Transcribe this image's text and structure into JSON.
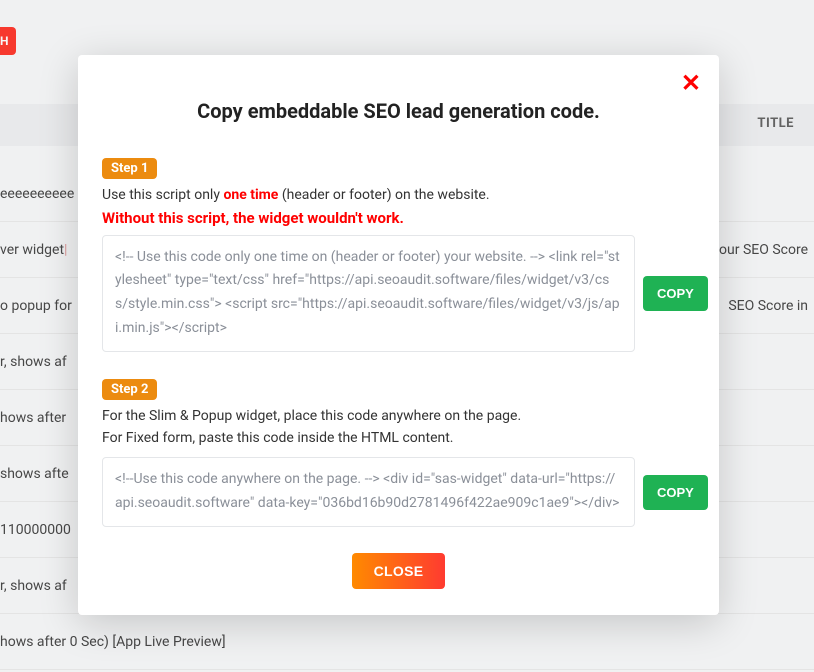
{
  "bg": {
    "top_btn": "H",
    "title_right": "TITLE",
    "rows_left": [
      "eeeeeeeeee",
      "ver widget ",
      "o popup for",
      "r, shows af",
      "hows after",
      "shows afte",
      "110000000",
      "r, shows af",
      "hows after 0 Sec) [App Live Preview]"
    ],
    "rows_right": [
      "our SEO Score",
      "SEO Score in"
    ],
    "row_left_tops": [
      166,
      222,
      278,
      334,
      390,
      446,
      502,
      558,
      614
    ],
    "row_right_tops": [
      222,
      278
    ]
  },
  "modal": {
    "title": "Copy embeddable SEO lead generation code.",
    "close_icon": "✕",
    "step1_badge": "Step 1",
    "step1_pre": "Use this script only ",
    "step1_bold": "one time",
    "step1_post": " (header or footer) on the website.",
    "step1_warn": "Without this script, the widget wouldn't work.",
    "code1": "<!-- Use this code only one time on (header or footer) your website. --> <link rel=\"stylesheet\" type=\"text/css\" href=\"https://api.seoaudit.software/files/widget/v3/css/style.min.css\"> <script src=\"https://api.seoaudit.software/files/widget/v3/js/api.min.js\"></script>",
    "copy1": "COPY",
    "step2_badge": "Step 2",
    "step2_line1": "For the Slim & Popup widget, place this code anywhere on the page.",
    "step2_line2": "For Fixed form, paste this code inside the HTML content.",
    "code2": "<!--Use this code anywhere on the page. --> <div id=\"sas-widget\" data-url=\"https://api.seoaudit.software\" data-key=\"036bd16b90d2781496f422ae909c1ae9\"></div>",
    "copy2": "COPY",
    "close_btn": "CLOSE"
  }
}
